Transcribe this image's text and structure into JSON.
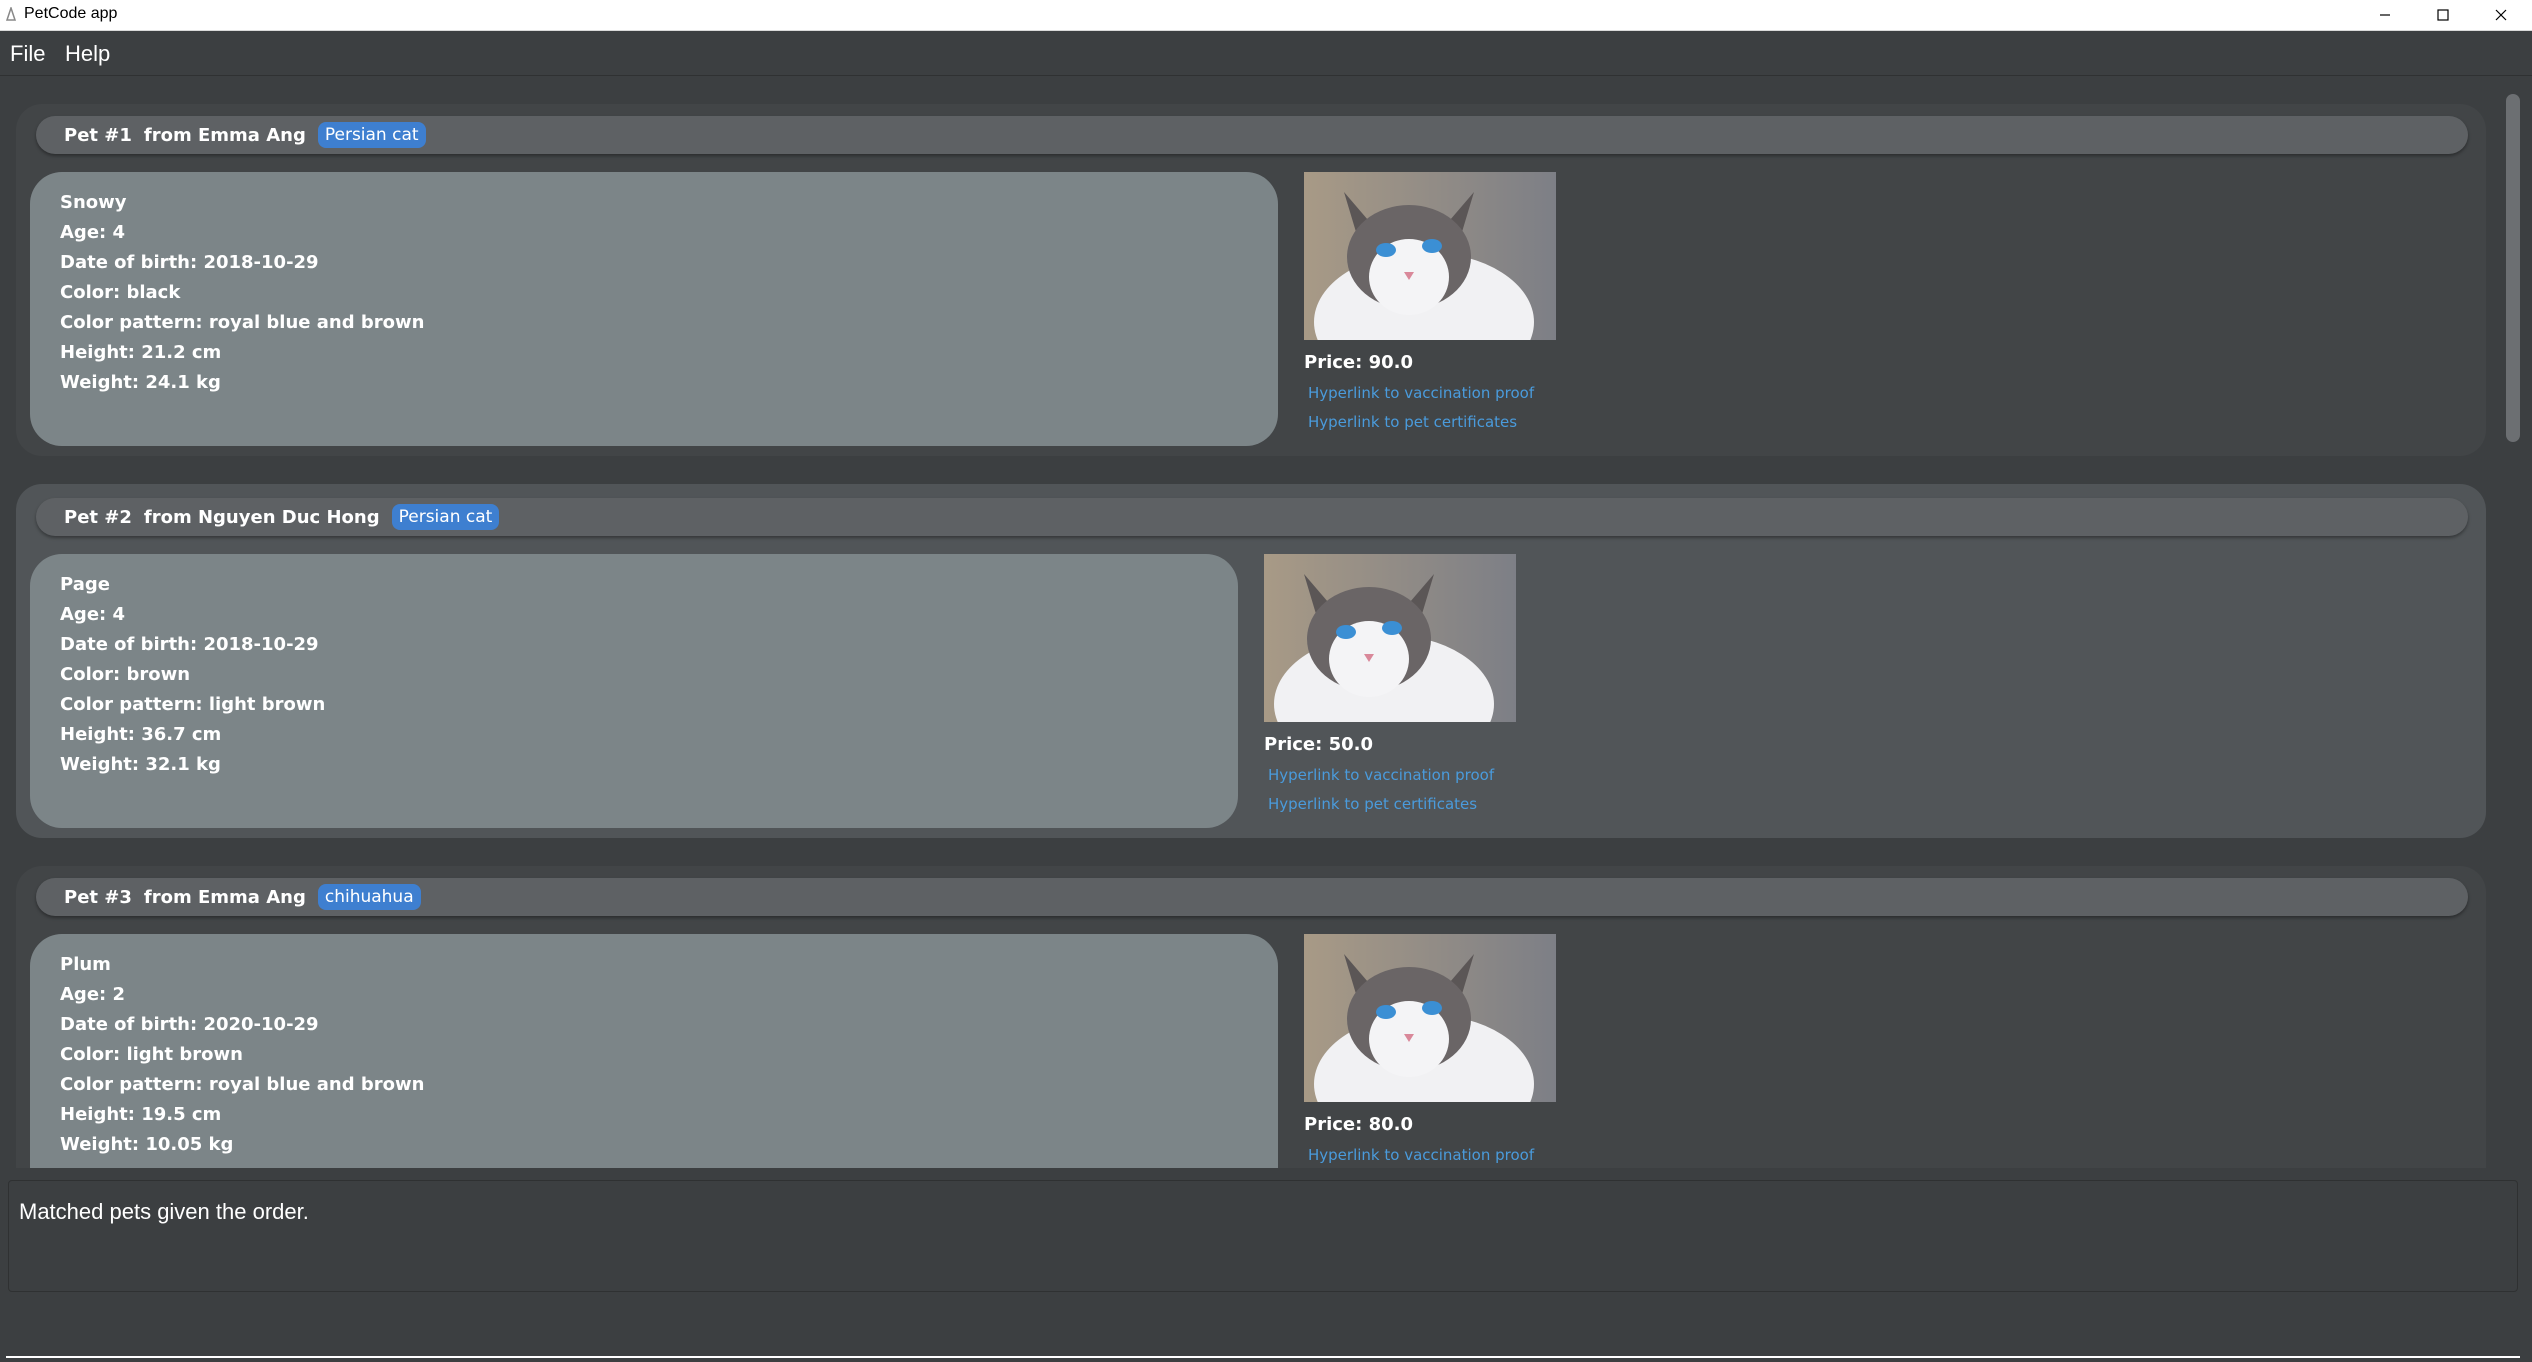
{
  "window": {
    "title": "PetCode app"
  },
  "menu": {
    "file": "File",
    "help": "Help"
  },
  "pets": [
    {
      "index_label": "Pet #1",
      "owner": "from Emma Ang",
      "tag": "Persian cat",
      "name": "Snowy",
      "age": "Age: 4",
      "dob": "Date of birth: 2018-10-29",
      "color": "Color: black",
      "pattern": "Color pattern: royal blue and brown",
      "height": "Height: 21.2 cm",
      "weight": "Weight: 24.1 kg",
      "price": "Price: 90.0",
      "vaccination_link": "Hyperlink to vaccination proof",
      "certificates_link": "Hyperlink to pet certificates"
    },
    {
      "index_label": "Pet #2",
      "owner": "from Nguyen Duc Hong",
      "tag": "Persian cat",
      "name": "Page",
      "age": "Age: 4",
      "dob": "Date of birth: 2018-10-29",
      "color": "Color: brown",
      "pattern": "Color pattern: light brown",
      "height": "Height: 36.7 cm",
      "weight": "Weight: 32.1 kg",
      "price": "Price: 50.0",
      "vaccination_link": "Hyperlink to vaccination proof",
      "certificates_link": "Hyperlink to pet certificates"
    },
    {
      "index_label": "Pet #3",
      "owner": "from Emma Ang",
      "tag": "chihuahua",
      "name": "Plum",
      "age": "Age: 2",
      "dob": "Date of birth: 2020-10-29",
      "color": "Color: light brown",
      "pattern": "Color pattern: royal blue and brown",
      "height": "Height: 19.5 cm",
      "weight": "Weight: 10.05 kg",
      "price": "Price: 80.0",
      "vaccination_link": "Hyperlink to vaccination proof"
    }
  ],
  "result": {
    "text": "Matched pets given the order."
  },
  "command": {
    "value": ""
  }
}
